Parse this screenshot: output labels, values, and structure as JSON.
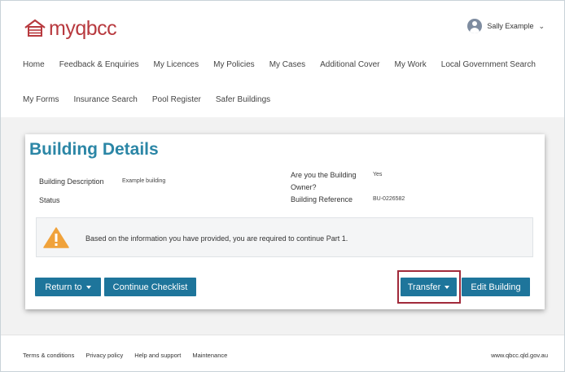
{
  "brand": {
    "name": "myqbcc",
    "color": "#b83a3f"
  },
  "user": {
    "name": "Sally Example"
  },
  "nav": {
    "row1": [
      "Home",
      "Feedback & Enquiries",
      "My Licences",
      "My Policies",
      "My Cases",
      "Additional Cover",
      "My Work",
      "Local Government Search"
    ],
    "row2": [
      "My Forms",
      "Insurance Search",
      "Pool Register",
      "Safer Buildings"
    ]
  },
  "page": {
    "title": "Building Details",
    "fields": {
      "description_label": "Building Description",
      "description_value": "Example building",
      "status_label": "Status",
      "owner_label_line1": "Are you the Building",
      "owner_label_line2": "Owner?",
      "owner_value": "Yes",
      "reference_label": "Building Reference",
      "reference_value": "BU-0226582"
    },
    "alert": {
      "icon": "warning-icon",
      "text": "Based on the information you have provided, you are required to continue Part 1."
    },
    "buttons": {
      "return_to": "Return to",
      "continue_checklist": "Continue Checklist",
      "transfer": "Transfer",
      "edit_building": "Edit Building"
    }
  },
  "footer": {
    "links": [
      "Terms & conditions",
      "Privacy policy",
      "Help and support",
      "Maintenance"
    ],
    "site": "www.qbcc.qld.gov.au"
  },
  "colors": {
    "accent": "#2b86a6",
    "button": "#1e759b",
    "highlight": "#a12a3a",
    "warning": "#f0a23b"
  }
}
